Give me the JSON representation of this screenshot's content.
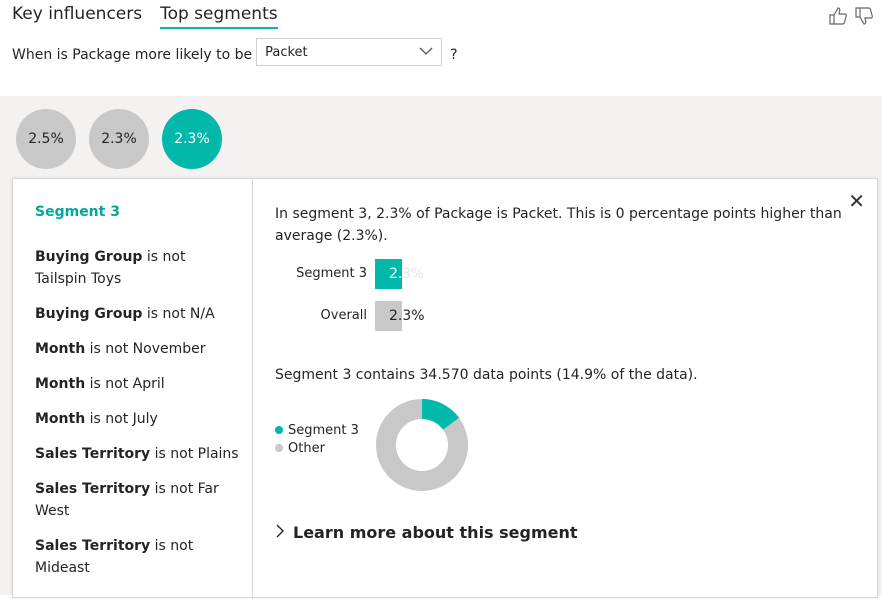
{
  "tabs": [
    {
      "label": "Key influencers",
      "active": false
    },
    {
      "label": "Top segments",
      "active": true
    }
  ],
  "question": {
    "prefix": "When is Package more likely to be",
    "dropdown_value": "Packet",
    "suffix": "?"
  },
  "bubbles": [
    {
      "label": "2.5%",
      "selected": false
    },
    {
      "label": "2.3%",
      "selected": false
    },
    {
      "label": "2.3%",
      "selected": true
    }
  ],
  "segment": {
    "title": "Segment 3",
    "conditions": [
      {
        "field": "Buying Group",
        "rest": " is not Tailspin Toys"
      },
      {
        "field": "Buying Group",
        "rest": " is not N/A"
      },
      {
        "field": "Month",
        "rest": " is not November"
      },
      {
        "field": "Month",
        "rest": " is not April"
      },
      {
        "field": "Month",
        "rest": " is not July"
      },
      {
        "field": "Sales Territory",
        "rest": " is not Plains"
      },
      {
        "field": "Sales Territory",
        "rest": " is not Far West"
      },
      {
        "field": "Sales Territory",
        "rest": " is not Mideast"
      }
    ]
  },
  "detail": {
    "description": "In segment 3, 2.3% of Package is Packet. This is 0 percentage points higher than average (2.3%).",
    "bars": [
      {
        "label": "Segment 3",
        "value": "2.3%",
        "color": "#01b8aa"
      },
      {
        "label": "Overall",
        "value": "2.3%",
        "color": "#c8c8c8"
      }
    ],
    "contains": "Segment 3 contains 34.570 data points (14.9% of the data).",
    "legend": [
      {
        "label": "Segment 3",
        "color": "#01b8aa"
      },
      {
        "label": "Other",
        "color": "#c8c8c8"
      }
    ],
    "donut_fraction": 0.149,
    "learn_more": "Learn more about this segment"
  },
  "colors": {
    "accent": "#01b8aa",
    "grey": "#c8c8c8"
  }
}
